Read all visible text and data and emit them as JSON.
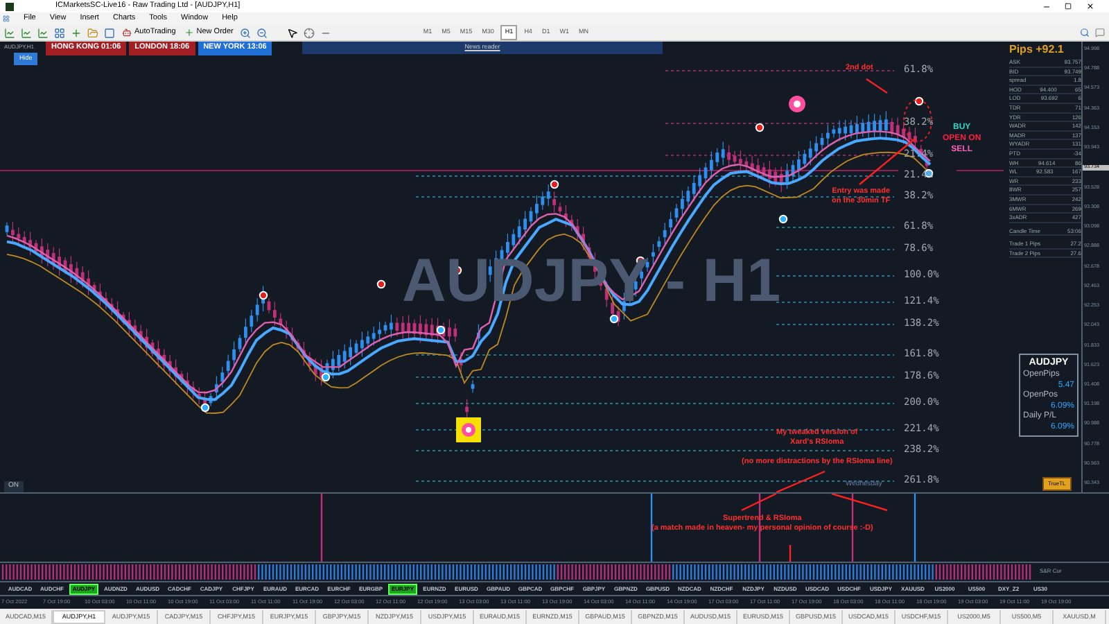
{
  "window": {
    "title": "ICMarketsSC-Live16 - Raw Trading Ltd - [AUDJPY,H1]"
  },
  "menu": [
    "File",
    "View",
    "Insert",
    "Charts",
    "Tools",
    "Window",
    "Help"
  ],
  "toolbar": {
    "buttons": [
      {
        "label": "AutoTrading",
        "kind": "auto"
      },
      {
        "label": "New Order",
        "kind": "order"
      }
    ],
    "timeframes": [
      {
        "label": "M1",
        "selected": false
      },
      {
        "label": "M5",
        "selected": false
      },
      {
        "label": "M15",
        "selected": false
      },
      {
        "label": "M30",
        "selected": false
      },
      {
        "label": "H1",
        "selected": true
      },
      {
        "label": "H4",
        "selected": false
      },
      {
        "label": "D1",
        "selected": false
      },
      {
        "label": "W1",
        "selected": false
      },
      {
        "label": "MN",
        "selected": false
      }
    ]
  },
  "chart": {
    "label": "AUDJPY,H1",
    "hide_button": "Hide",
    "sessions": [
      {
        "label": "HONG KONG 01:06",
        "color": "#a31f24"
      },
      {
        "label": "LONDON 18:06",
        "color": "#a31f24"
      },
      {
        "label": "NEW YORK 13:06",
        "color": "#1f6fd6"
      }
    ],
    "news_reader": "News reader",
    "watermark": "AUDJPY - H1",
    "fib_levels": [
      "61.8%",
      "38.2%",
      "21.4%",
      "21.4%",
      "38.2%",
      "61.8%",
      "78.6%",
      "100.0%",
      "121.4%",
      "138.2%",
      "161.8%",
      "178.6%",
      "200.0%",
      "221.4%",
      "238.2%",
      "261.8%"
    ],
    "day_label": "Wednesday",
    "status": "ON",
    "signals": [
      {
        "label": "BUY",
        "kind": "buy"
      },
      {
        "label": "OPEN ON",
        "kind": "open"
      },
      {
        "label": "SELL",
        "kind": "sell"
      }
    ],
    "annotations": [
      {
        "lines": [
          "2nd dot"
        ]
      },
      {
        "lines": [
          "Entry was made",
          "on the 30min TF"
        ]
      },
      {
        "lines": [
          "My tweaked version of",
          "Xard's RSIoma"
        ]
      },
      {
        "lines": [
          "(no more distractions by the RSIoma line)"
        ]
      },
      {
        "lines": [
          "Supertrend & RSIoma",
          "(a match made in heaven- my personal opinion of course :-D)"
        ]
      }
    ],
    "pips": "Pips +92.1",
    "stats": [
      {
        "cells": [
          "ASK",
          "93.757"
        ]
      },
      {
        "cells": [
          "BID",
          "93.749"
        ]
      },
      {
        "cells": [
          "spread",
          "1.8"
        ]
      },
      {
        "cells": [
          "HOD",
          "94.400",
          "65"
        ]
      },
      {
        "cells": [
          "LOD",
          "93.692",
          "6"
        ]
      },
      {
        "cells": [
          "TDR",
          "71"
        ]
      },
      {
        "cells": [
          "YDR",
          "126"
        ]
      },
      {
        "cells": [
          "WADR",
          "142"
        ]
      },
      {
        "cells": [
          "MADR",
          "137"
        ]
      },
      {
        "cells": [
          "WYADR",
          "131"
        ]
      },
      {
        "cells": [
          "PTD",
          "-34"
        ]
      },
      {
        "cells": [
          "WH",
          "94.614",
          "86"
        ]
      },
      {
        "cells": [
          "WL",
          "92.583",
          "167"
        ]
      },
      {
        "cells": [
          "WR",
          "233"
        ]
      },
      {
        "cells": [
          "8WR",
          "257"
        ]
      },
      {
        "cells": [
          "3MWR",
          "242"
        ]
      },
      {
        "cells": [
          "6MWR",
          "269"
        ]
      },
      {
        "cells": [
          "3xADR",
          "427"
        ]
      },
      {
        "cells": [
          "Candle Time",
          "53:06"
        ]
      },
      {
        "cells": [
          "Trade 1 Pips",
          "27.2"
        ]
      },
      {
        "cells": [
          "Trade 2 Pips",
          "27.6"
        ]
      }
    ],
    "position_box": {
      "symbol": "AUDJPY",
      "items": [
        {
          "label": "OpenPips",
          "value": "5.47"
        },
        {
          "label": "OpenPos",
          "value": "6.09%"
        },
        {
          "label": "Daily P/L",
          "value": "6.09%"
        }
      ]
    },
    "truetl_button": "TrueTL",
    "price_axis": [
      {
        "label": "94.998",
        "current": false
      },
      {
        "label": "94.788",
        "current": false
      },
      {
        "label": "94.573",
        "current": false
      },
      {
        "label": "94.363",
        "current": false
      },
      {
        "label": "94.153",
        "current": false
      },
      {
        "label": "93.943",
        "current": false
      },
      {
        "label": "93.734",
        "current": true
      },
      {
        "label": "93.528",
        "current": false
      },
      {
        "label": "93.308",
        "current": false
      },
      {
        "label": "93.098",
        "current": false
      },
      {
        "label": "92.888",
        "current": false
      },
      {
        "label": "92.678",
        "current": false
      },
      {
        "label": "92.463",
        "current": false
      },
      {
        "label": "92.253",
        "current": false
      },
      {
        "label": "92.043",
        "current": false
      },
      {
        "label": "91.833",
        "current": false
      },
      {
        "label": "91.623",
        "current": false
      },
      {
        "label": "91.408",
        "current": false
      },
      {
        "label": "91.198",
        "current": false
      },
      {
        "label": "90.988",
        "current": false
      },
      {
        "label": "90.778",
        "current": false
      },
      {
        "label": "90.563",
        "current": false
      },
      {
        "label": "90.343",
        "current": false
      }
    ]
  },
  "indicator": {
    "label": "S&R Cur"
  },
  "symbols": [
    {
      "label": "AUDCAD",
      "selected": false
    },
    {
      "label": "AUDCHF",
      "selected": false
    },
    {
      "label": "AUDJPY",
      "selected": true
    },
    {
      "label": "AUDNZD",
      "selected": false
    },
    {
      "label": "AUDUSD",
      "selected": false
    },
    {
      "label": "CADCHF",
      "selected": false
    },
    {
      "label": "CADJPY",
      "selected": false
    },
    {
      "label": "CHFJPY",
      "selected": false
    },
    {
      "label": "EURAUD",
      "selected": false
    },
    {
      "label": "EURCAD",
      "selected": false
    },
    {
      "label": "EURCHF",
      "selected": false
    },
    {
      "label": "EURGBP",
      "selected": false
    },
    {
      "label": "EURJPY",
      "selected": true
    },
    {
      "label": "EURNZD",
      "selected": false
    },
    {
      "label": "EURUSD",
      "selected": false
    },
    {
      "label": "GBPAUD",
      "selected": false
    },
    {
      "label": "GBPCAD",
      "selected": false
    },
    {
      "label": "GBPCHF",
      "selected": false
    },
    {
      "label": "GBPJPY",
      "selected": false
    },
    {
      "label": "GBPNZD",
      "selected": false
    },
    {
      "label": "GBPUSD",
      "selected": false
    },
    {
      "label": "NZDCAD",
      "selected": false
    },
    {
      "label": "NZDCHF",
      "selected": false
    },
    {
      "label": "NZDJPY",
      "selected": false
    },
    {
      "label": "NZDUSD",
      "selected": false
    },
    {
      "label": "USDCAD",
      "selected": false
    },
    {
      "label": "USDCHF",
      "selected": false
    },
    {
      "label": "USDJPY",
      "selected": false
    },
    {
      "label": "XAUUSD",
      "selected": false
    },
    {
      "label": "US2000",
      "selected": false
    },
    {
      "label": "US500",
      "selected": false
    },
    {
      "label": "DXY_Z2",
      "selected": false
    },
    {
      "label": "US30",
      "selected": false
    }
  ],
  "time_axis": [
    "7 Oct 2022",
    "7 Oct 19:00",
    "10 Oct 03:00",
    "10 Oct 11:00",
    "10 Oct 19:00",
    "11 Oct 03:00",
    "11 Oct 11:00",
    "11 Oct 19:00",
    "12 Oct 03:00",
    "12 Oct 11:00",
    "12 Oct 19:00",
    "13 Oct 03:00",
    "13 Oct 11:00",
    "13 Oct 19:00",
    "14 Oct 03:00",
    "14 Oct 11:00",
    "14 Oct 19:00",
    "17 Oct 03:00",
    "17 Oct 11:00",
    "17 Oct 19:00",
    "18 Oct 03:00",
    "18 Oct 11:00",
    "18 Oct 19:00",
    "19 Oct 03:00",
    "19 Oct 11:00",
    "19 Oct 19:00"
  ],
  "tabs": [
    {
      "label": "AUDCAD,M15",
      "selected": false
    },
    {
      "label": "AUDJPY,H1",
      "selected": true
    },
    {
      "label": "AUDJPY,M15",
      "selected": false
    },
    {
      "label": "CADJPY,M15",
      "selected": false
    },
    {
      "label": "CHFJPY,M15",
      "selected": false
    },
    {
      "label": "EURJPY,M15",
      "selected": false
    },
    {
      "label": "GBPJPY,M15",
      "selected": false
    },
    {
      "label": "NZDJPY,M15",
      "selected": false
    },
    {
      "label": "USDJPY,M15",
      "selected": false
    },
    {
      "label": "EURAUD,M15",
      "selected": false
    },
    {
      "label": "EURNZD,M15",
      "selected": false
    },
    {
      "label": "GBPAUD,M15",
      "selected": false
    },
    {
      "label": "GBPNZD,M15",
      "selected": false
    },
    {
      "label": "AUDUSD,M15",
      "selected": false
    },
    {
      "label": "EURUSD,M15",
      "selected": false
    },
    {
      "label": "GBPUSD,M15",
      "selected": false
    },
    {
      "label": "USDCAD,M15",
      "selected": false
    },
    {
      "label": "USDCHF,M15",
      "selected": false
    },
    {
      "label": "US2000,M5",
      "selected": false
    },
    {
      "label": "US500,M5",
      "selected": false
    },
    {
      "label": "XAUUSD,M",
      "selected": false
    }
  ]
}
